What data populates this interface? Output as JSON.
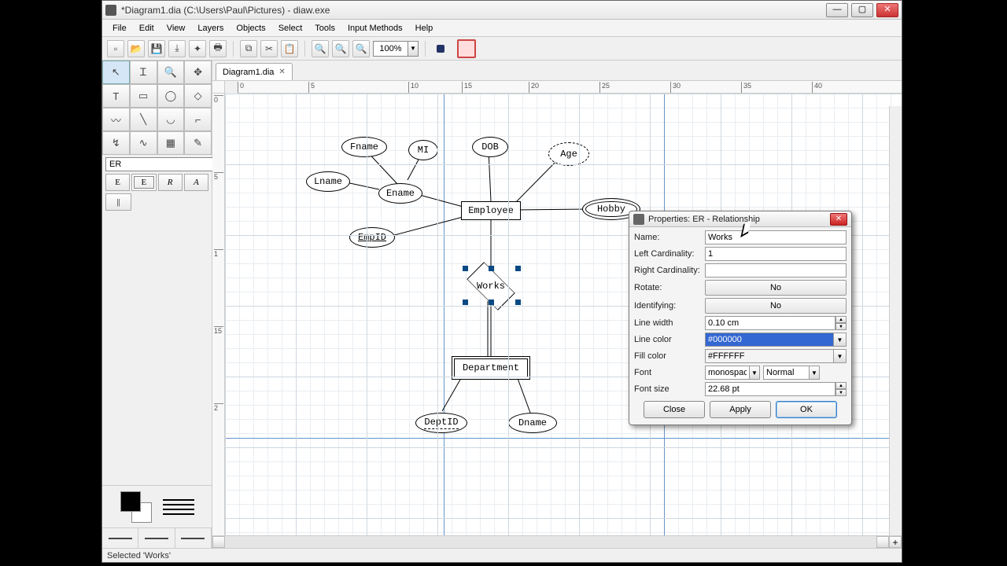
{
  "title": "*Diagram1.dia (C:\\Users\\Paul\\Pictures) - diaw.exe",
  "menu": [
    "File",
    "Edit",
    "View",
    "Layers",
    "Objects",
    "Select",
    "Tools",
    "Input Methods",
    "Help"
  ],
  "zoom": "100%",
  "sheet": "ER",
  "sheetShapes": [
    "E",
    "E",
    "R",
    "A",
    "||"
  ],
  "tab": "Diagram1.dia",
  "rulerH": {
    "0": 0,
    "5": 90,
    "10": 217,
    "15": 285,
    "20": 370,
    "25": 460,
    "30": 550,
    "35": 640,
    "40": 730
  },
  "rulerV": {
    "0": 2,
    "5": 100,
    "1": 198,
    "15": 296,
    "2": 394
  },
  "er": {
    "fname": "Fname",
    "mi": "MI",
    "dob": "DOB",
    "age": "Age",
    "lname": "Lname",
    "ename": "Ename",
    "employee": "Employee",
    "hobby": "Hobby",
    "empid": "EmpID",
    "works": "Works",
    "department": "Department",
    "deptid": "DeptID",
    "dname": "Dname"
  },
  "dialog": {
    "title": "Properties: ER - Relationship",
    "name_lbl": "Name:",
    "name_val": "Works",
    "lcard_lbl": "Left Cardinality:",
    "lcard_val": "1",
    "rcard_lbl": "Right Cardinality:",
    "rcard_val": "",
    "rotate_lbl": "Rotate:",
    "rotate_val": "No",
    "ident_lbl": "Identifying:",
    "ident_val": "No",
    "lw_lbl": "Line width",
    "lw_val": "0.10 cm",
    "lc_lbl": "Line color",
    "lc_val": "#000000",
    "fc_lbl": "Fill color",
    "fc_val": "#FFFFFF",
    "font_lbl": "Font",
    "font_family": "monospace",
    "font_style": "Normal",
    "fs_lbl": "Font size",
    "fs_val": "22.68 pt",
    "close": "Close",
    "apply": "Apply",
    "ok": "OK"
  },
  "status": "Selected 'Works'"
}
